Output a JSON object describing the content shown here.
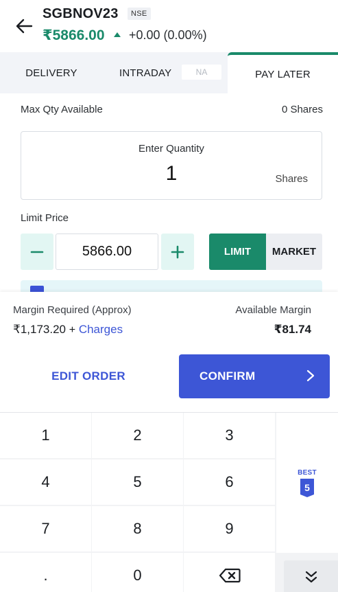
{
  "header": {
    "symbol": "SGBNOV23",
    "exchange": "NSE",
    "ltp": "₹5866.00",
    "change": "+0.00 (0.00%)",
    "change_direction_icon": "up-triangle-icon",
    "back_icon": "arrow-left-icon"
  },
  "tabs": [
    {
      "label": "DELIVERY",
      "active": false
    },
    {
      "label": "INTRADAY",
      "active": false,
      "badge": "NA"
    },
    {
      "label": "PAY LATER",
      "active": true
    }
  ],
  "order": {
    "max_qty_label": "Max Qty Available",
    "max_qty_value": "0 Shares",
    "qty_label": "Enter Quantity",
    "qty_value": "1",
    "qty_unit": "Shares",
    "limit_price_label": "Limit Price",
    "limit_price_value": "5866.00",
    "order_types": [
      "LIMIT",
      "MARKET"
    ],
    "selected_order_type": "LIMIT"
  },
  "margin": {
    "required_label": "Margin Required (Approx)",
    "required_value": "₹1,173.20",
    "plus": "+",
    "charges_link": "Charges",
    "available_label": "Available Margin",
    "available_value": "₹81.74"
  },
  "actions": {
    "edit_label": "EDIT ORDER",
    "confirm_label": "CONFIRM"
  },
  "keypad": {
    "keys": [
      "1",
      "2",
      "3",
      "4",
      "5",
      "6",
      "7",
      "8",
      "9",
      ".",
      "0"
    ],
    "backspace_icon": "backspace-icon",
    "best_label": "BEST",
    "best_count": "5",
    "collapse_icon": "double-chevron-down-icon"
  },
  "colors": {
    "accent_green": "#1a8a6a",
    "primary_blue": "#3d56d6",
    "tab_bg": "#f2f4f8",
    "stepper_bg": "#e2f6f3"
  }
}
